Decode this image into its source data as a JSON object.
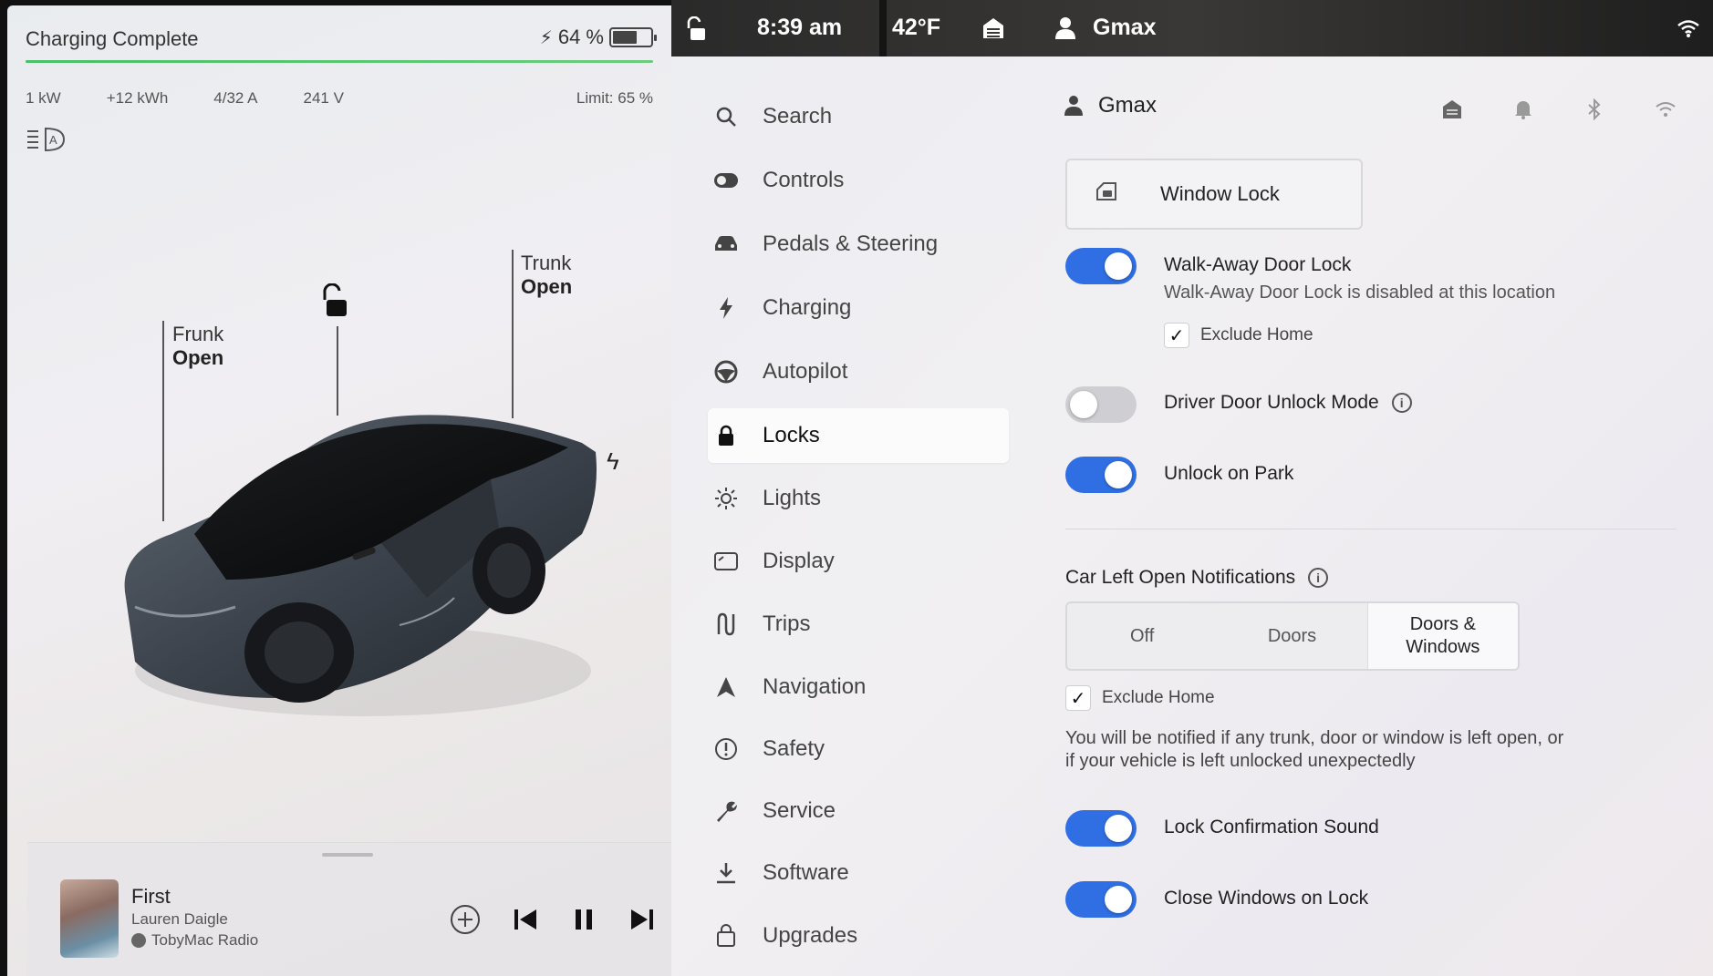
{
  "charging": {
    "status": "Charging Complete",
    "battery_pct": "64 %",
    "battery_level": 0.64,
    "power": "1 kW",
    "energy_added": "+12 kWh",
    "current": "4/32 A",
    "voltage": "241 V",
    "limit": "Limit: 65 %",
    "accent_color": "#4bbf6a"
  },
  "vehicle": {
    "frunk_label": "Frunk",
    "frunk_state": "Open",
    "trunk_label": "Trunk",
    "trunk_state": "Open"
  },
  "media": {
    "title": "First",
    "artist": "Lauren Daigle",
    "station": "TobyMac Radio"
  },
  "status_bar": {
    "time": "8:39 am",
    "temperature": "42°F",
    "user": "Gmax"
  },
  "nav": {
    "items": [
      {
        "label": "Search",
        "icon": "search-icon"
      },
      {
        "label": "Controls",
        "icon": "toggle-icon"
      },
      {
        "label": "Pedals & Steering",
        "icon": "car-icon"
      },
      {
        "label": "Charging",
        "icon": "bolt-icon"
      },
      {
        "label": "Autopilot",
        "icon": "steering-wheel-icon"
      },
      {
        "label": "Locks",
        "icon": "lock-icon",
        "active": true
      },
      {
        "label": "Lights",
        "icon": "sun-icon"
      },
      {
        "label": "Display",
        "icon": "display-icon"
      },
      {
        "label": "Trips",
        "icon": "trips-icon"
      },
      {
        "label": "Navigation",
        "icon": "navigation-icon"
      },
      {
        "label": "Safety",
        "icon": "safety-icon"
      },
      {
        "label": "Service",
        "icon": "wrench-icon"
      },
      {
        "label": "Software",
        "icon": "download-icon"
      },
      {
        "label": "Upgrades",
        "icon": "bag-icon"
      }
    ]
  },
  "locks": {
    "profile": "Gmax",
    "window_lock": "Window Lock",
    "walk_away": {
      "label": "Walk-Away Door Lock",
      "sub": "Walk-Away Door Lock is disabled at this location",
      "exclude_home": "Exclude Home",
      "on": true
    },
    "driver_door_unlock": {
      "label": "Driver Door Unlock Mode",
      "on": false
    },
    "unlock_on_park": {
      "label": "Unlock on Park",
      "on": true
    },
    "car_left_open": {
      "label": "Car Left Open Notifications",
      "options": [
        "Off",
        "Doors",
        "Doors & Windows"
      ],
      "selected": "Doors & Windows",
      "exclude_home": "Exclude Home",
      "notice": "You will be notified if any trunk, door or window is left open, or if your vehicle is left unlocked unexpectedly"
    },
    "lock_sound": {
      "label": "Lock Confirmation Sound",
      "on": true
    },
    "close_windows": {
      "label": "Close Windows on Lock",
      "on": true
    },
    "toggle_color": "#2f6fe3"
  }
}
